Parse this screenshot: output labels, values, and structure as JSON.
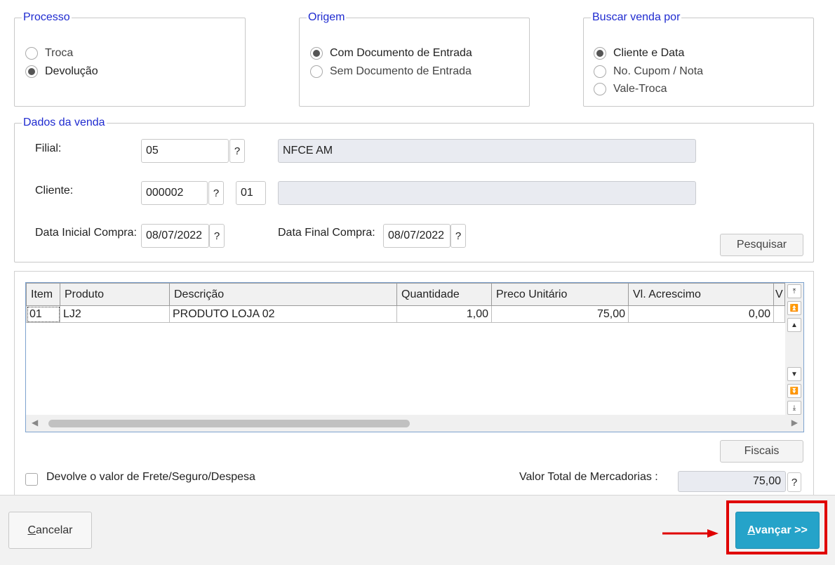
{
  "processo": {
    "legend": "Processo",
    "options": [
      {
        "label": "Troca",
        "selected": false
      },
      {
        "label": "Devolução",
        "selected": true
      }
    ]
  },
  "origem": {
    "legend": "Origem",
    "options": [
      {
        "label": "Com Documento de Entrada",
        "selected": true
      },
      {
        "label": "Sem Documento de Entrada",
        "selected": false
      }
    ]
  },
  "buscar": {
    "legend": "Buscar venda por",
    "options": [
      {
        "label": "Cliente e Data",
        "selected": true
      },
      {
        "label": "No. Cupom / Nota",
        "selected": false
      },
      {
        "label": "Vale-Troca",
        "selected": false
      }
    ]
  },
  "dados": {
    "legend": "Dados da venda",
    "filial_label": "Filial:",
    "filial_value": "05",
    "filial_desc": "NFCE AM",
    "cliente_label": "Cliente:",
    "cliente_value": "000002",
    "loja_value": "01",
    "cliente_desc": "",
    "data_inicial_label": "Data Inicial Compra:",
    "data_inicial_value": "08/07/2022",
    "data_final_label": "Data Final Compra:",
    "data_final_value": "08/07/2022",
    "lookup": "?",
    "pesquisar": "Pesquisar"
  },
  "grid": {
    "columns": [
      "Item",
      "Produto",
      "Descrição",
      "Quantidade",
      "Preco Unitário",
      "Vl. Acrescimo",
      "V"
    ],
    "rows": [
      [
        "01",
        "LJ2",
        "PRODUTO LOJA 02",
        "1,00",
        "75,00",
        "0,00",
        ""
      ]
    ]
  },
  "fiscais": "Fiscais",
  "devolve_frete": "Devolve o valor de Frete/Seguro/Despesa",
  "total_label": "Valor Total de Mercadorias :",
  "total_value": "75,00",
  "footer": {
    "cancelar_pre": "",
    "cancelar_ul": "C",
    "cancelar_post": "ancelar",
    "avancar_pre": "",
    "avancar_ul": "A",
    "avancar_post": "vançar >>"
  },
  "colors": {
    "legend": "#1f2bd0",
    "primary": "#25a3c9",
    "highlight": "#e00000"
  }
}
